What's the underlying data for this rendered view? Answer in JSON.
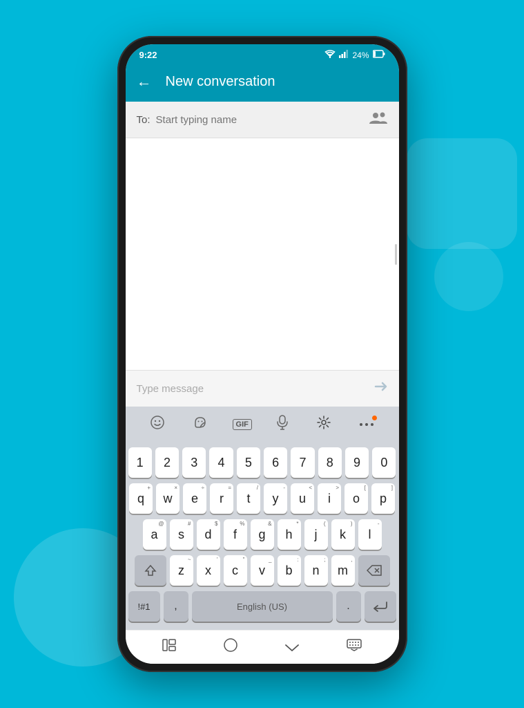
{
  "background": {
    "color": "#00b8d9"
  },
  "status_bar": {
    "time": "9:22",
    "sim_icon": "⊟",
    "wifi": "WiFi",
    "signal": "Signal",
    "battery": "24%"
  },
  "header": {
    "back_label": "←",
    "title": "New conversation"
  },
  "to_field": {
    "label": "To:",
    "placeholder": "Start typing name"
  },
  "message_area": {
    "placeholder": ""
  },
  "message_bar": {
    "placeholder": "Type message",
    "send_icon": "▷"
  },
  "keyboard_toolbar": {
    "emoji_icon": "☺",
    "sticker_icon": "❤",
    "gif_label": "GIF",
    "mic_icon": "🎤",
    "settings_icon": "⚙",
    "more_icon": "•••"
  },
  "keyboard": {
    "row_numbers": [
      "1",
      "2",
      "3",
      "4",
      "5",
      "6",
      "7",
      "8",
      "9",
      "0"
    ],
    "row_qwerty": [
      "q",
      "w",
      "e",
      "r",
      "t",
      "y",
      "u",
      "i",
      "o",
      "p"
    ],
    "row_asdf": [
      "a",
      "s",
      "d",
      "f",
      "g",
      "h",
      "j",
      "k",
      "l"
    ],
    "row_zxcv": [
      "z",
      "x",
      "c",
      "v",
      "b",
      "n",
      "m"
    ],
    "sub_chars": {
      "q": "+",
      "w": "×",
      "e": "÷",
      "r": "=",
      "t": "/",
      "y": "-",
      "u": "<",
      "i": ">",
      "o": "[",
      "p": "]",
      "a": "@",
      "s": "#",
      "d": "$",
      "f": "%",
      "g": "&",
      "h": "*",
      "j": "(",
      "k": ")",
      "l": "-",
      "z": "~",
      "x": "'",
      "c": "\"",
      "v": "_",
      "b": ":",
      "n": ";",
      "m": ","
    },
    "special": {
      "shift": "⇧",
      "backspace": "⌫",
      "numbers": "!#1",
      "comma": ",",
      "space_label": "English (US)",
      "period": ".",
      "enter": "↵"
    }
  },
  "nav_bar": {
    "recent_label": "|||",
    "home_label": "○",
    "back_label": "∨",
    "keyboard_label": "⌨"
  }
}
